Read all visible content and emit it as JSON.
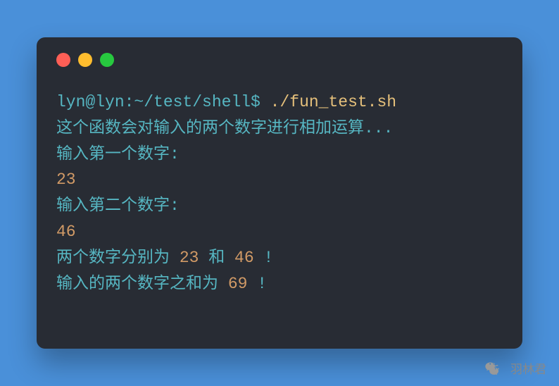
{
  "terminal": {
    "prompt": "lyn@lyn:~/test/shell$ ",
    "command": "./fun_test.sh",
    "lines": {
      "intro": "这个函数会对输入的两个数字进行相加运算...",
      "prompt1": "输入第一个数字: ",
      "input1": "23",
      "prompt2": "输入第二个数字: ",
      "input2": "46",
      "result1_a": "两个数字分别为 ",
      "result1_v1": "23",
      "result1_b": " 和 ",
      "result1_v2": "46",
      "result1_c": " !",
      "result2_a": "输入的两个数字之和为 ",
      "result2_v": "69",
      "result2_b": " !"
    }
  },
  "watermark": {
    "text": "羽林君"
  }
}
